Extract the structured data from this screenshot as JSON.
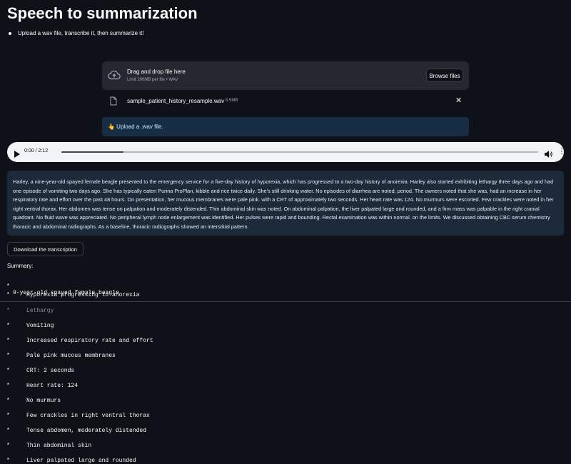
{
  "page": {
    "title": "Speech to summarization",
    "bullet": "Upload a wav file, transcribe it, then summarize it!"
  },
  "uploader": {
    "drag_text": "Drag and drop file here",
    "limit_text": "Limit 200MB per file • WAV",
    "browse_label": "Browse files",
    "file_name": "sample_patient_history_resample.wav",
    "file_size": "8.5MB",
    "close_glyph": "✕",
    "info_message": "👆 Upload a .wav file."
  },
  "audio": {
    "time": "0:00 / 2:12",
    "progress": 0.13,
    "more_glyph": "⋮"
  },
  "transcript": {
    "text": "Harley, a nine-year-old spayed female beagle presented to the emergency service for a five-day history of hyporexia, which has progressed to a two-day history of anorexia. Harley also started exhibiting lethargy three days ago and had one episode of vomiting two days ago. She has typically eaten Purina ProPlan, kibble and rice twice daily. She's still drinking water. No episodes of diarrhea are noted, period. The owners noted that she was, had an increase in her respiratory rate and effort over the past 48 hours. On presentation, her mucous membranes were pale pink. with a CRT of approximately two seconds. Her heart rate was 124. No murmurs were escorted. Few crackles were noted in her right ventral thorax. Her abdomen was tense on palpation and moderately distended. Thin abdominal skin was noted. On abdominal palpation, the liver palpated large and rounded, and a firm mass was palpable in the right cranial quadrant. No fluid wave was appreciated. No peripheral lymph node enlargement was identified. Her pulses were rapid and bounding. Rectal examination was within normal. on the limits. We discussed obtaining CBC serum chemistry thoracic and abdominal radiographs. As a baseline, thoracic radiographs showed an interstitial pattern."
  },
  "download_label": "Download the transcription",
  "summary": {
    "label": "Summary:",
    "first": "9-year-old spayed female beagle",
    "items": [
      "Hyporexia progressing to anorexia",
      "Lethargy",
      "Vomiting",
      "Increased respiratory rate and effort",
      "Pale pink mucous membranes",
      "CRT: 2 seconds",
      "Heart rate: 124",
      "No murmurs",
      "Few crackles in right ventral thorax",
      "Tense abdomen, moderately distended",
      "Thin abdominal skin",
      "Liver palpated large and rounded"
    ]
  },
  "icons": {
    "upload": "cloud-upload-icon",
    "file": "file-icon",
    "close": "close-icon",
    "play": "play-icon",
    "volume": "volume-icon",
    "more": "more-vertical-icon"
  }
}
